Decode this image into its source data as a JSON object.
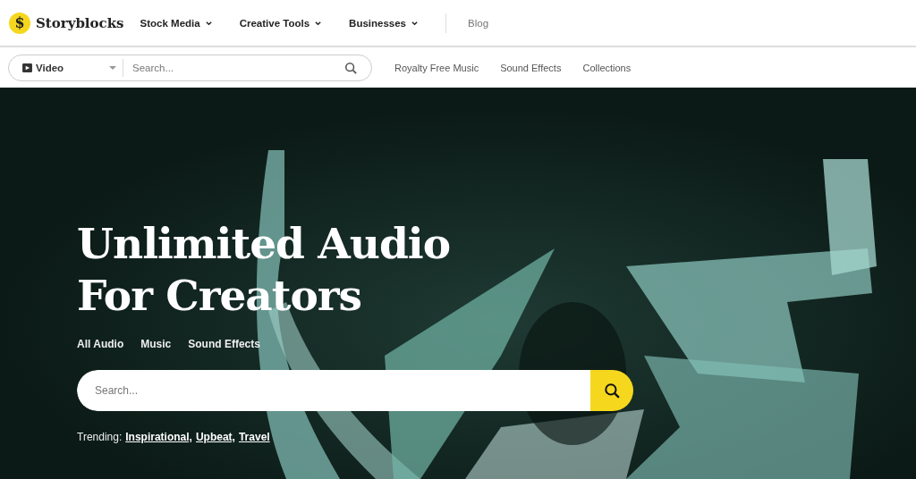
{
  "brand": {
    "name": "Storyblocks",
    "logo_letter": "$"
  },
  "nav": [
    {
      "label": "Stock Media",
      "dropdown": true
    },
    {
      "label": "Creative Tools",
      "dropdown": true
    },
    {
      "label": "Businesses",
      "dropdown": true
    },
    {
      "label": "Blog",
      "dropdown": false
    }
  ],
  "search_bar": {
    "media_type": "Video",
    "placeholder": "Search..."
  },
  "sub_nav": [
    "Royalty Free Music",
    "Sound Effects",
    "Collections"
  ],
  "hero": {
    "kind": "picture",
    "title_lines": [
      "Unlimited Audio",
      "For Creators"
    ],
    "tabs": [
      "All Audio",
      "Music",
      "Sound Effects"
    ],
    "search": {
      "placeholder": "Search..."
    },
    "trending_label": "Trending:",
    "trending": [
      "Inspirational,",
      "Upbeat,",
      "Travel"
    ]
  }
}
